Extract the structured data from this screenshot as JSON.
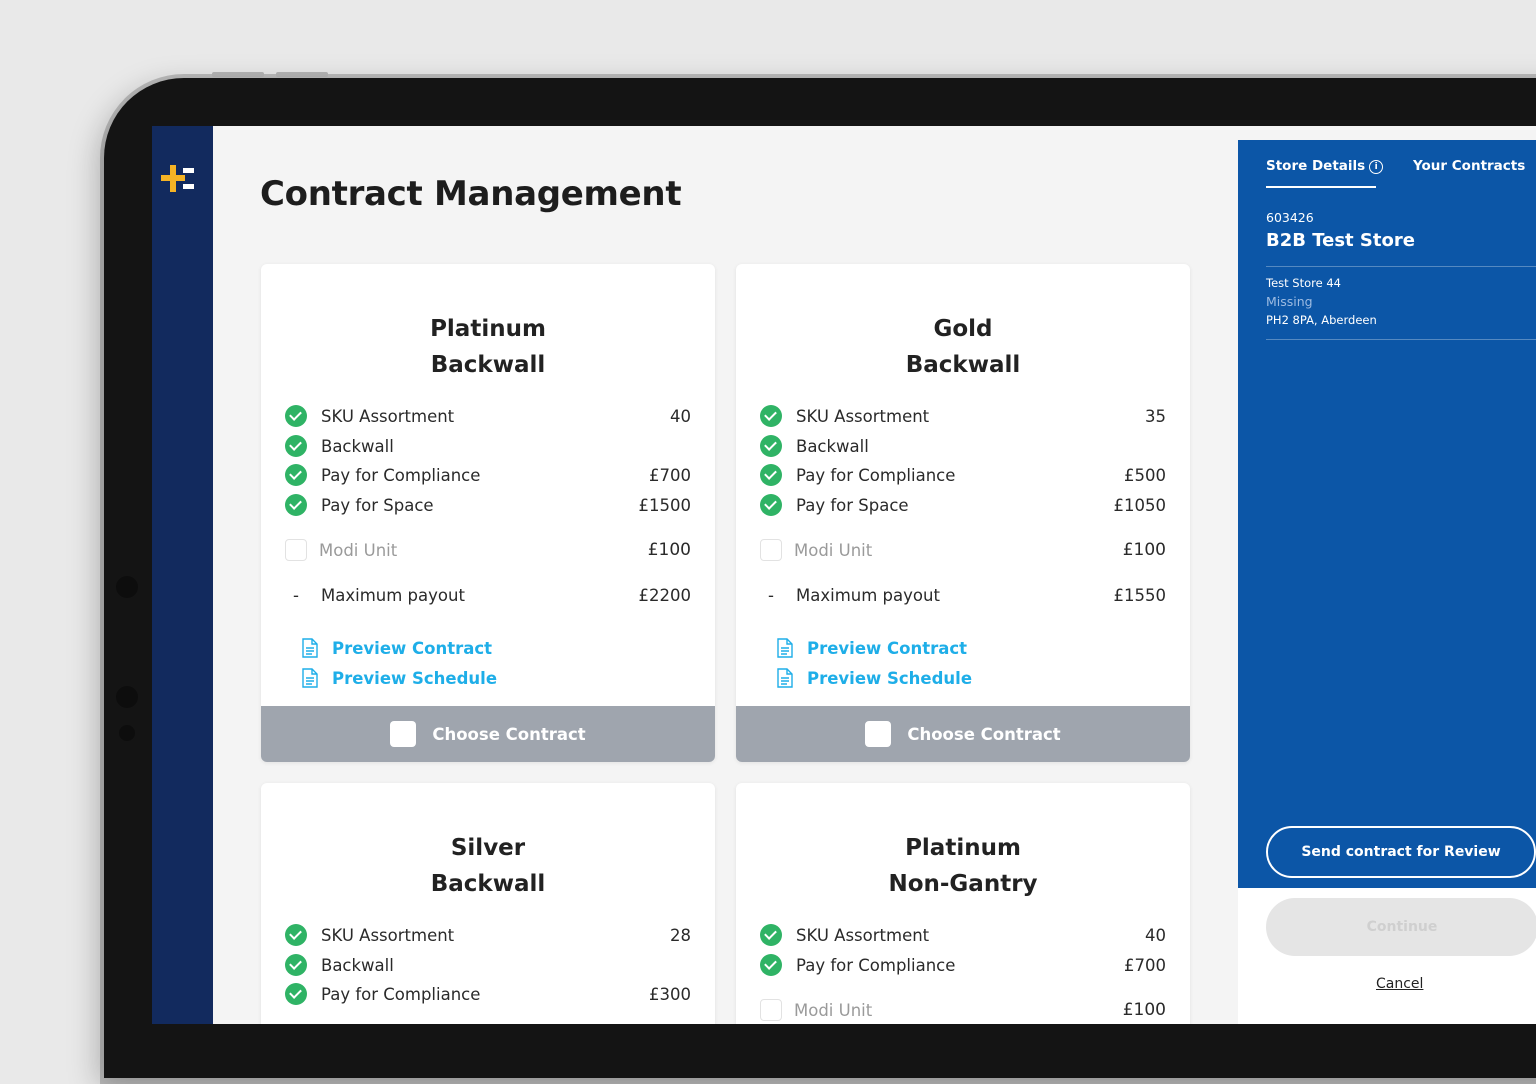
{
  "page": {
    "title": "Contract Management"
  },
  "contracts": [
    {
      "title_line1": "Platinum",
      "title_line2": "Backwall",
      "features": [
        {
          "name": "SKU Assortment",
          "value": "40"
        },
        {
          "name": "Backwall",
          "value": ""
        },
        {
          "name": "Pay for Compliance",
          "value": "£700"
        },
        {
          "name": "Pay for Space",
          "value": "£1500"
        }
      ],
      "optional": {
        "name": "Modi Unit",
        "value": "£100"
      },
      "max_payout": {
        "label": "Maximum payout",
        "value": "£2200"
      },
      "links": [
        "Preview Contract",
        "Preview Schedule"
      ],
      "choose_label": "Choose Contract"
    },
    {
      "title_line1": "Gold",
      "title_line2": "Backwall",
      "features": [
        {
          "name": "SKU Assortment",
          "value": "35"
        },
        {
          "name": "Backwall",
          "value": ""
        },
        {
          "name": "Pay for Compliance",
          "value": "£500"
        },
        {
          "name": "Pay for Space",
          "value": "£1050"
        }
      ],
      "optional": {
        "name": "Modi Unit",
        "value": "£100"
      },
      "max_payout": {
        "label": "Maximum payout",
        "value": "£1550"
      },
      "links": [
        "Preview Contract",
        "Preview Schedule"
      ],
      "choose_label": "Choose Contract"
    },
    {
      "title_line1": "Silver",
      "title_line2": "Backwall",
      "features": [
        {
          "name": "SKU Assortment",
          "value": "28"
        },
        {
          "name": "Backwall",
          "value": ""
        },
        {
          "name": "Pay for Compliance",
          "value": "£300"
        }
      ]
    },
    {
      "title_line1": "Platinum",
      "title_line2": "Non-Gantry",
      "features": [
        {
          "name": "SKU Assortment",
          "value": "40"
        },
        {
          "name": "Pay for Compliance",
          "value": "£700"
        }
      ],
      "optional": {
        "name": "Modi Unit",
        "value": "£100"
      }
    }
  ],
  "panel": {
    "tabs": [
      "Store Details",
      "Your Contracts"
    ],
    "info_glyph": "i",
    "store_id": "603426",
    "store_name": "B2B Test Store",
    "address_line1": "Test Store 44",
    "address_line2": "Missing",
    "address_line3": "PH2 8PA, Aberdeen",
    "send_label": "Send contract for Review",
    "continue_label": "Continue",
    "cancel_label": "Cancel"
  },
  "icons": {
    "logo": "plus-equals-logo-icon",
    "check": "check-circle-icon",
    "document": "document-icon",
    "info": "info-icon"
  },
  "colors": {
    "rail": "#122a5e",
    "logo_accent": "#f5b325",
    "panel": "#0c56a7",
    "check": "#2fb365",
    "link": "#1eaee8",
    "choose_button": "#9fa5ae"
  }
}
